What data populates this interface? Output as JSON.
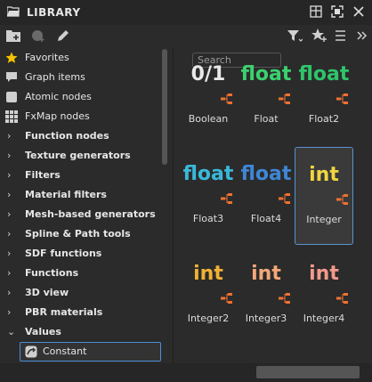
{
  "window": {
    "title": "LIBRARY"
  },
  "toolbar": {
    "search_placeholder": "Search"
  },
  "sidebar": {
    "items": [
      {
        "label": "Favorites",
        "icon": "star-icon",
        "bold": false,
        "chevron": ""
      },
      {
        "label": "Graph items",
        "icon": "comment-icon",
        "bold": false,
        "chevron": ""
      },
      {
        "label": "Atomic nodes",
        "icon": "atomic-node-icon",
        "bold": false,
        "chevron": ""
      },
      {
        "label": "FxMap nodes",
        "icon": "grid-icon",
        "bold": false,
        "chevron": ""
      },
      {
        "label": "Function nodes",
        "bold": true,
        "chevron": "›"
      },
      {
        "label": "Texture generators",
        "bold": true,
        "chevron": "›"
      },
      {
        "label": "Filters",
        "bold": true,
        "chevron": "›"
      },
      {
        "label": "Material filters",
        "bold": true,
        "chevron": "›"
      },
      {
        "label": "Mesh-based generators",
        "bold": true,
        "chevron": "›"
      },
      {
        "label": "Spline & Path tools",
        "bold": true,
        "chevron": "›"
      },
      {
        "label": "SDF functions",
        "bold": true,
        "chevron": "›"
      },
      {
        "label": "Functions",
        "bold": true,
        "chevron": "›"
      },
      {
        "label": "3D view",
        "bold": true,
        "chevron": "›"
      },
      {
        "label": "PBR materials",
        "bold": true,
        "chevron": "›"
      },
      {
        "label": "Values",
        "bold": true,
        "chevron": "⌄"
      }
    ],
    "selected": {
      "label": "Constant",
      "icon": "constant-icon"
    }
  },
  "tiles": [
    {
      "thumb": "0/1",
      "caption": "Boolean",
      "color": "#e8e8e8"
    },
    {
      "thumb": "float",
      "caption": "Float",
      "color": "#3bd16f"
    },
    {
      "thumb": "float",
      "caption": "Float2",
      "color": "#2fc46a"
    },
    {
      "thumb": "float",
      "caption": "Float3",
      "color": "#39b8d8"
    },
    {
      "thumb": "float",
      "caption": "Float4",
      "color": "#3f86d6"
    },
    {
      "thumb": "int",
      "caption": "Integer",
      "color": "#f0d640",
      "selected": true
    },
    {
      "thumb": "int",
      "caption": "Integer2",
      "color": "#f0b235"
    },
    {
      "thumb": "int",
      "caption": "Integer3",
      "color": "#f3a878"
    },
    {
      "thumb": "int",
      "caption": "Integer4",
      "color": "#f29a8c"
    }
  ],
  "colors": {
    "accent": "#4a8fd6",
    "node_connector": "#f07030",
    "star": "#f5c400"
  }
}
